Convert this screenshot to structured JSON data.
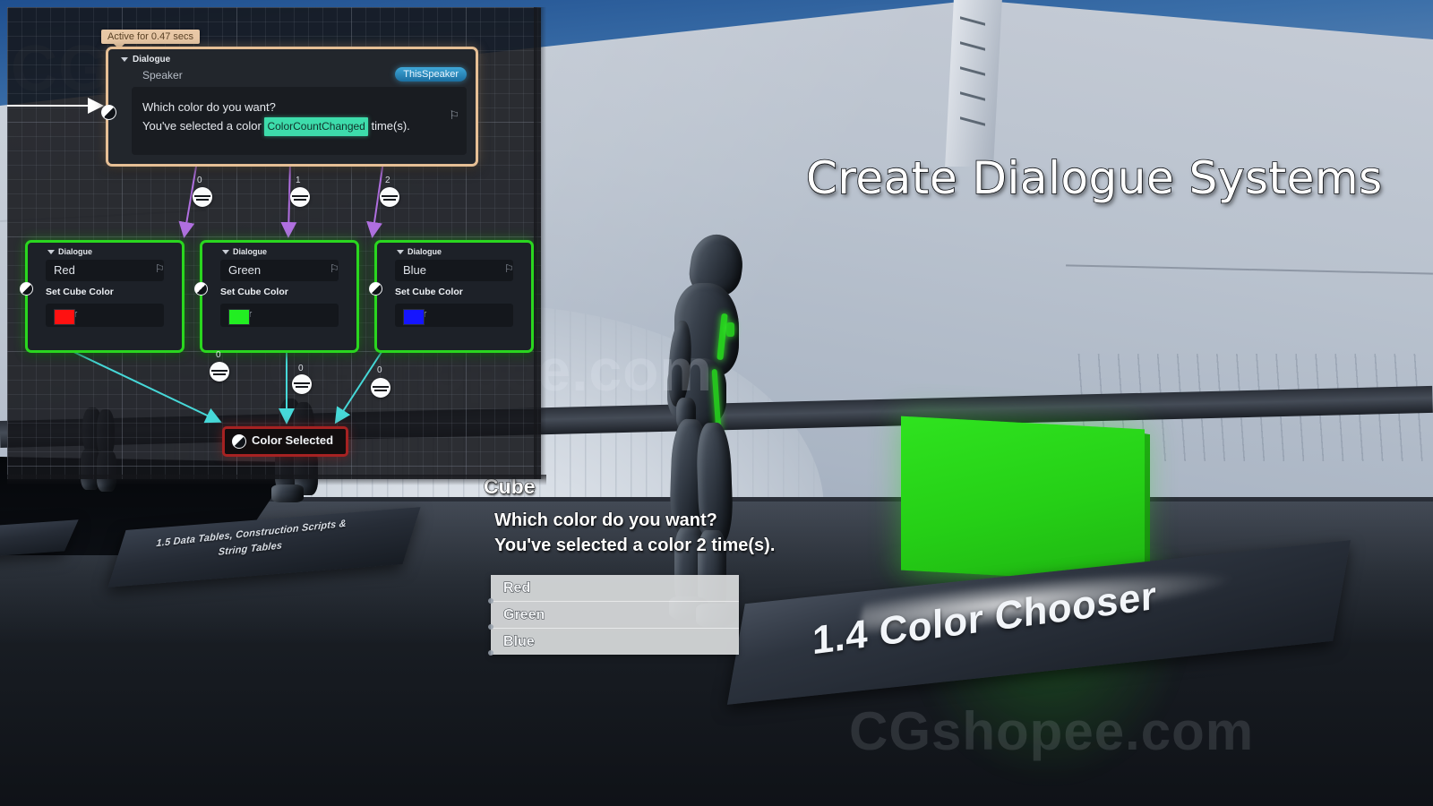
{
  "scene": {
    "hero_title": "Create Dialogue Systems",
    "podium_left_line1": "1.5 Data Tables, Construction Scripts &",
    "podium_left_line2": "String Tables",
    "podium_right_label": "1.4 Color Chooser",
    "cube_color": "#26d316"
  },
  "watermarks": {
    "top": "CGshopee.com",
    "middle": "CGshopee.com",
    "bottom": "CGshopee.com"
  },
  "game_dialogue": {
    "speaker": "Cube",
    "line1": "Which color do you want?",
    "line2": "You've selected a color 2 time(s).",
    "choices": [
      "Red",
      "Green",
      "Blue"
    ]
  },
  "blueprint": {
    "active_tooltip": "Active for 0.47 secs",
    "root_node": {
      "header": "Dialogue",
      "speaker_label": "Speaker",
      "speaker_value": "ThisSpeaker",
      "text_line1": "Which color do you want?",
      "text_prefix": "You've selected a color",
      "text_variable": "ColorCountChanged",
      "text_suffix": "time(s)."
    },
    "color_nodes": [
      {
        "header": "Dialogue",
        "option": "Red",
        "action": "Set Cube Color",
        "param_label": "Color",
        "swatch": "#ff1111",
        "index": "0"
      },
      {
        "header": "Dialogue",
        "option": "Green",
        "action": "Set Cube Color",
        "param_label": "Color",
        "swatch": "#22ee22",
        "index": "1"
      },
      {
        "header": "Dialogue",
        "option": "Blue",
        "action": "Set Cube Color",
        "param_label": "Color",
        "swatch": "#1515ff",
        "index": "2"
      }
    ],
    "lower_reroute_indices": [
      "0",
      "0",
      "0"
    ],
    "end_node": {
      "label": "Color Selected"
    }
  }
}
